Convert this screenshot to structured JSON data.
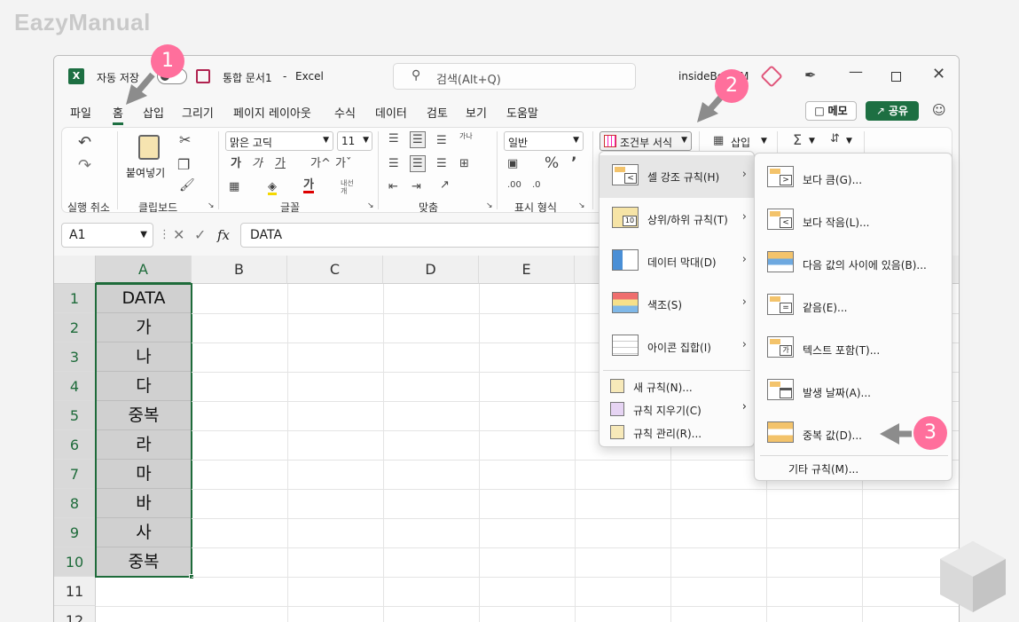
{
  "watermark": "EazyManual",
  "titlebar": {
    "autosave": "자동 저장",
    "document": "통합 문서1",
    "dash": "-",
    "app": "Excel",
    "search_placeholder": "검색(Alt+Q)",
    "user": "insideBox",
    "user_suffix": "M"
  },
  "menu": [
    "파일",
    "홈",
    "삽입",
    "그리기",
    "페이지 레이아웃",
    "수식",
    "데이터",
    "검토",
    "보기",
    "도움말"
  ],
  "memo_label": "메모",
  "share_label": "공유",
  "ribbon": {
    "undo_group": "실행 취소",
    "paste": "붙여넣기",
    "clipboard_group": "클립보드",
    "font_name": "맑은 고딕",
    "font_size": "11",
    "font_group": "글꼴",
    "align_group": "맞춤",
    "number_format": "일반",
    "number_group": "표시 형식",
    "cond_format": "조건부 서식",
    "insert": "삽입",
    "sym_wrap": "내선 개",
    "sym_dir": "가나"
  },
  "formula": {
    "namebox": "A1",
    "fx": "fx",
    "value": "DATA"
  },
  "columns": [
    "A",
    "B",
    "C",
    "D",
    "E"
  ],
  "rows": [
    {
      "num": "1",
      "val": "DATA"
    },
    {
      "num": "2",
      "val": "가"
    },
    {
      "num": "3",
      "val": "나"
    },
    {
      "num": "4",
      "val": "다"
    },
    {
      "num": "5",
      "val": "중복"
    },
    {
      "num": "6",
      "val": "라"
    },
    {
      "num": "7",
      "val": "마"
    },
    {
      "num": "8",
      "val": "바"
    },
    {
      "num": "9",
      "val": "사"
    },
    {
      "num": "10",
      "val": "중복"
    },
    {
      "num": "11",
      "val": ""
    },
    {
      "num": "12",
      "val": ""
    }
  ],
  "cf_menu": {
    "highlight": "셀 강조 규칙(H)",
    "topbottom": "상위/하위 규칙(T)",
    "databar": "데이터 막대(D)",
    "colorscale": "색조(S)",
    "iconset": "아이콘 집합(I)",
    "new_rule": "새 규칙(N)...",
    "clear_rule": "규칙 지우기(C)",
    "manage_rule": "규칙 관리(R)..."
  },
  "sub_menu": {
    "greater": "보다 큼(G)...",
    "less": "보다 작음(L)...",
    "between": "다음 값의 사이에 있음(B)...",
    "equal": "같음(E)...",
    "text": "텍스트 포함(T)...",
    "date": "발생 날짜(A)...",
    "duplicate": "중복 값(D)...",
    "more": "기타 규칙(M)..."
  },
  "badges": [
    "1",
    "2",
    "3"
  ]
}
